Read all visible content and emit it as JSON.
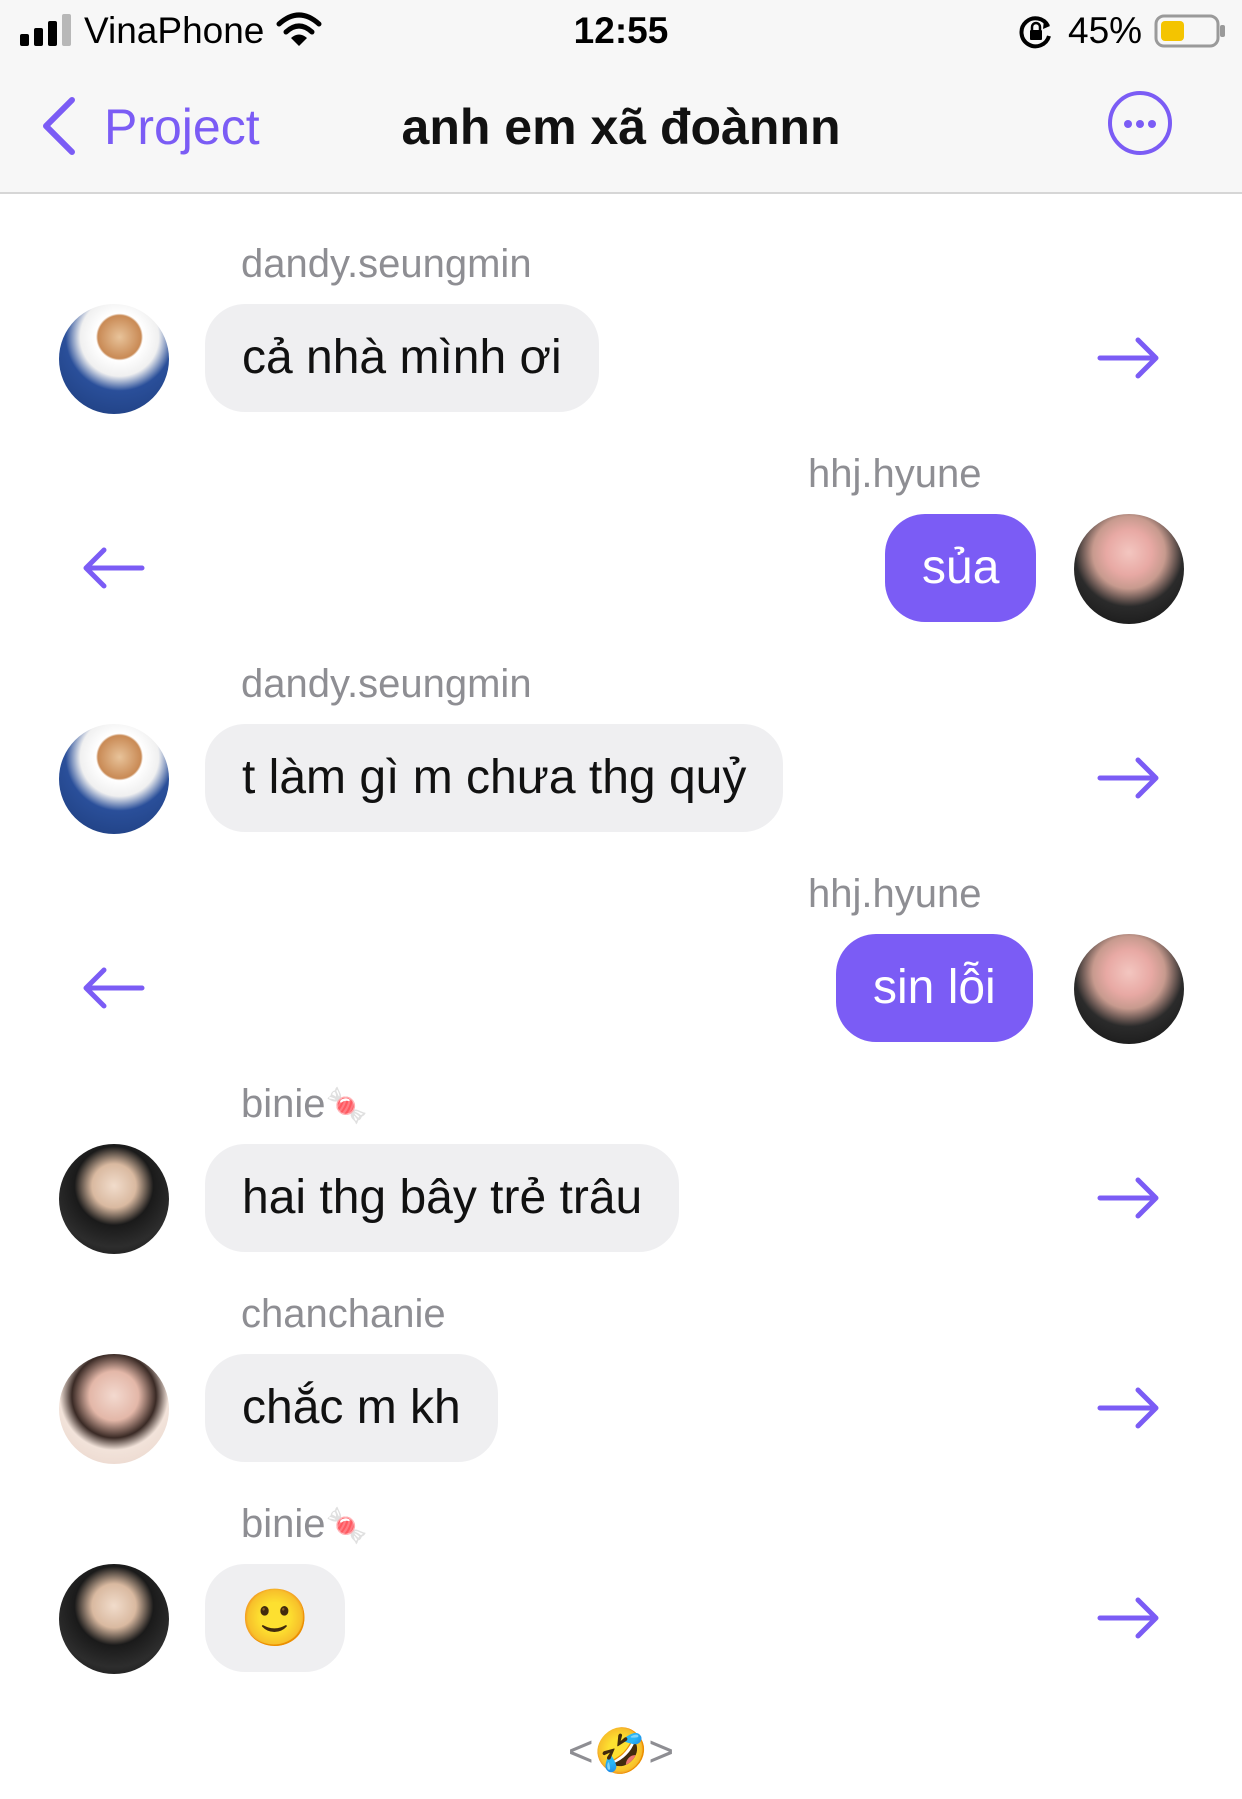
{
  "status_bar": {
    "carrier": "VinaPhone",
    "time": "12:55",
    "battery": "45%",
    "battery_level": 0.45
  },
  "header": {
    "back_label": "Project",
    "title": "anh em xã đoànnn"
  },
  "messages": [
    {
      "sender": "dandy.seungmin",
      "text": "cả nhà mình ơi",
      "direction": "incoming"
    },
    {
      "sender": "hhj.hyune",
      "text": "sủa",
      "direction": "outgoing"
    },
    {
      "sender": "dandy.seungmin",
      "text": "t làm gì m chưa thg quỷ",
      "direction": "incoming"
    },
    {
      "sender": "hhj.hyune",
      "text": "sin lỗi",
      "direction": "outgoing"
    },
    {
      "sender": "binie",
      "sender_emoji": "🍬",
      "text": "hai thg bây trẻ trâu",
      "direction": "incoming"
    },
    {
      "sender": "chanchanie",
      "text": "chắc m kh",
      "direction": "incoming"
    },
    {
      "sender": "binie",
      "sender_emoji": "🍬",
      "text": "🙂",
      "direction": "incoming"
    }
  ],
  "footer": {
    "reaction": "<🤣>"
  },
  "colors": {
    "accent": "#7b5cf5",
    "incoming_bubble": "#efeff1",
    "sender_text": "#8e8e93"
  }
}
